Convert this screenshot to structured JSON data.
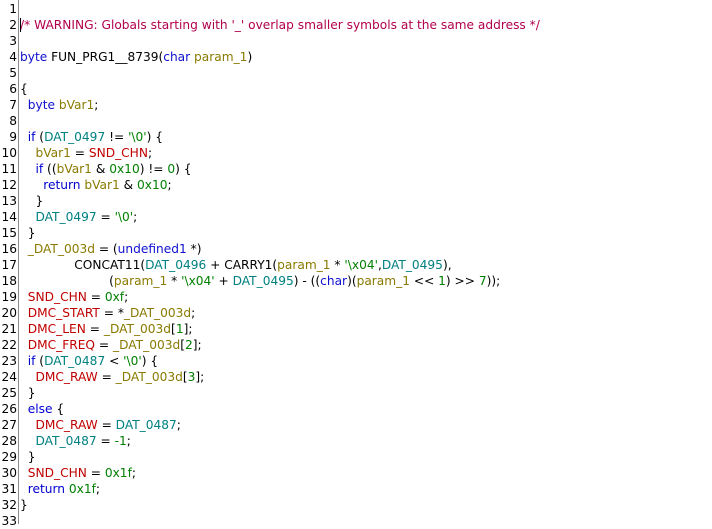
{
  "editor": {
    "lines": [
      {
        "n": "1",
        "tokens": []
      },
      {
        "n": "2",
        "tokens": [
          {
            "t": "/* WARNING: Globals starting with '_' overlap smaller symbols at the same address */",
            "c": "comment"
          }
        ]
      },
      {
        "n": "3",
        "tokens": []
      },
      {
        "n": "4",
        "tokens": [
          {
            "t": "byte ",
            "c": "type"
          },
          {
            "t": "FUN_PRG1__8739",
            "c": "func"
          },
          {
            "t": "(",
            "c": "plain"
          },
          {
            "t": "char ",
            "c": "type"
          },
          {
            "t": "param_1",
            "c": "param"
          },
          {
            "t": ")",
            "c": "plain"
          }
        ]
      },
      {
        "n": "5",
        "tokens": []
      },
      {
        "n": "6",
        "tokens": [
          {
            "t": "{",
            "c": "plain"
          }
        ]
      },
      {
        "n": "7",
        "tokens": [
          {
            "t": "  ",
            "c": "plain"
          },
          {
            "t": "byte ",
            "c": "type"
          },
          {
            "t": "bVar1",
            "c": "var"
          },
          {
            "t": ";",
            "c": "plain"
          }
        ]
      },
      {
        "n": "8",
        "tokens": []
      },
      {
        "n": "9",
        "tokens": [
          {
            "t": "  ",
            "c": "plain"
          },
          {
            "t": "if",
            "c": "keyword"
          },
          {
            "t": " (",
            "c": "plain"
          },
          {
            "t": "DAT_0497",
            "c": "global"
          },
          {
            "t": " != ",
            "c": "plain"
          },
          {
            "t": "'\\0'",
            "c": "const"
          },
          {
            "t": ") {",
            "c": "plain"
          }
        ]
      },
      {
        "n": "10",
        "tokens": [
          {
            "t": "    ",
            "c": "plain"
          },
          {
            "t": "bVar1",
            "c": "var"
          },
          {
            "t": " = ",
            "c": "plain"
          },
          {
            "t": "SND_CHN",
            "c": "sym"
          },
          {
            "t": ";",
            "c": "plain"
          }
        ]
      },
      {
        "n": "11",
        "tokens": [
          {
            "t": "    ",
            "c": "plain"
          },
          {
            "t": "if",
            "c": "keyword"
          },
          {
            "t": " ((",
            "c": "plain"
          },
          {
            "t": "bVar1",
            "c": "var"
          },
          {
            "t": " & ",
            "c": "plain"
          },
          {
            "t": "0x10",
            "c": "const"
          },
          {
            "t": ") != ",
            "c": "plain"
          },
          {
            "t": "0",
            "c": "const"
          },
          {
            "t": ") {",
            "c": "plain"
          }
        ]
      },
      {
        "n": "12",
        "tokens": [
          {
            "t": "      ",
            "c": "plain"
          },
          {
            "t": "return",
            "c": "keyword"
          },
          {
            "t": " ",
            "c": "plain"
          },
          {
            "t": "bVar1",
            "c": "var"
          },
          {
            "t": " & ",
            "c": "plain"
          },
          {
            "t": "0x10",
            "c": "const"
          },
          {
            "t": ";",
            "c": "plain"
          }
        ]
      },
      {
        "n": "13",
        "tokens": [
          {
            "t": "    }",
            "c": "plain"
          }
        ]
      },
      {
        "n": "14",
        "tokens": [
          {
            "t": "    ",
            "c": "plain"
          },
          {
            "t": "DAT_0497",
            "c": "global"
          },
          {
            "t": " = ",
            "c": "plain"
          },
          {
            "t": "'\\0'",
            "c": "const"
          },
          {
            "t": ";",
            "c": "plain"
          }
        ]
      },
      {
        "n": "15",
        "tokens": [
          {
            "t": "  }",
            "c": "plain"
          }
        ]
      },
      {
        "n": "16",
        "tokens": [
          {
            "t": "  ",
            "c": "plain"
          },
          {
            "t": "_DAT_003d",
            "c": "var"
          },
          {
            "t": " = (",
            "c": "plain"
          },
          {
            "t": "undefined1",
            "c": "type"
          },
          {
            "t": " *)",
            "c": "plain"
          }
        ]
      },
      {
        "n": "17",
        "tokens": [
          {
            "t": "              ",
            "c": "plain"
          },
          {
            "t": "CONCAT11",
            "c": "func"
          },
          {
            "t": "(",
            "c": "plain"
          },
          {
            "t": "DAT_0496",
            "c": "global"
          },
          {
            "t": " + ",
            "c": "plain"
          },
          {
            "t": "CARRY1",
            "c": "func"
          },
          {
            "t": "(",
            "c": "plain"
          },
          {
            "t": "param_1",
            "c": "param"
          },
          {
            "t": " * ",
            "c": "plain"
          },
          {
            "t": "'\\x04'",
            "c": "const"
          },
          {
            "t": ",",
            "c": "plain"
          },
          {
            "t": "DAT_0495",
            "c": "global"
          },
          {
            "t": "),",
            "c": "plain"
          }
        ]
      },
      {
        "n": "18",
        "tokens": [
          {
            "t": "                       (",
            "c": "plain"
          },
          {
            "t": "param_1",
            "c": "param"
          },
          {
            "t": " * ",
            "c": "plain"
          },
          {
            "t": "'\\x04'",
            "c": "const"
          },
          {
            "t": " + ",
            "c": "plain"
          },
          {
            "t": "DAT_0495",
            "c": "global"
          },
          {
            "t": ") - ((",
            "c": "plain"
          },
          {
            "t": "char",
            "c": "type"
          },
          {
            "t": ")(",
            "c": "plain"
          },
          {
            "t": "param_1",
            "c": "param"
          },
          {
            "t": " << ",
            "c": "plain"
          },
          {
            "t": "1",
            "c": "const"
          },
          {
            "t": ") >> ",
            "c": "plain"
          },
          {
            "t": "7",
            "c": "const"
          },
          {
            "t": "));",
            "c": "plain"
          }
        ]
      },
      {
        "n": "19",
        "tokens": [
          {
            "t": "  ",
            "c": "plain"
          },
          {
            "t": "SND_CHN",
            "c": "sym"
          },
          {
            "t": " = ",
            "c": "plain"
          },
          {
            "t": "0xf",
            "c": "const"
          },
          {
            "t": ";",
            "c": "plain"
          }
        ]
      },
      {
        "n": "20",
        "tokens": [
          {
            "t": "  ",
            "c": "plain"
          },
          {
            "t": "DMC_START",
            "c": "sym"
          },
          {
            "t": " = *",
            "c": "plain"
          },
          {
            "t": "_DAT_003d",
            "c": "var"
          },
          {
            "t": ";",
            "c": "plain"
          }
        ]
      },
      {
        "n": "21",
        "tokens": [
          {
            "t": "  ",
            "c": "plain"
          },
          {
            "t": "DMC_LEN",
            "c": "sym"
          },
          {
            "t": " = ",
            "c": "plain"
          },
          {
            "t": "_DAT_003d",
            "c": "var"
          },
          {
            "t": "[",
            "c": "plain"
          },
          {
            "t": "1",
            "c": "const"
          },
          {
            "t": "];",
            "c": "plain"
          }
        ]
      },
      {
        "n": "22",
        "tokens": [
          {
            "t": "  ",
            "c": "plain"
          },
          {
            "t": "DMC_FREQ",
            "c": "sym"
          },
          {
            "t": " = ",
            "c": "plain"
          },
          {
            "t": "_DAT_003d",
            "c": "var"
          },
          {
            "t": "[",
            "c": "plain"
          },
          {
            "t": "2",
            "c": "const"
          },
          {
            "t": "];",
            "c": "plain"
          }
        ]
      },
      {
        "n": "23",
        "tokens": [
          {
            "t": "  ",
            "c": "plain"
          },
          {
            "t": "if",
            "c": "keyword"
          },
          {
            "t": " (",
            "c": "plain"
          },
          {
            "t": "DAT_0487",
            "c": "global"
          },
          {
            "t": " < ",
            "c": "plain"
          },
          {
            "t": "'\\0'",
            "c": "const"
          },
          {
            "t": ") {",
            "c": "plain"
          }
        ]
      },
      {
        "n": "24",
        "tokens": [
          {
            "t": "    ",
            "c": "plain"
          },
          {
            "t": "DMC_RAW",
            "c": "sym"
          },
          {
            "t": " = ",
            "c": "plain"
          },
          {
            "t": "_DAT_003d",
            "c": "var"
          },
          {
            "t": "[",
            "c": "plain"
          },
          {
            "t": "3",
            "c": "const"
          },
          {
            "t": "];",
            "c": "plain"
          }
        ]
      },
      {
        "n": "25",
        "tokens": [
          {
            "t": "  }",
            "c": "plain"
          }
        ]
      },
      {
        "n": "26",
        "tokens": [
          {
            "t": "  ",
            "c": "plain"
          },
          {
            "t": "else",
            "c": "keyword"
          },
          {
            "t": " {",
            "c": "plain"
          }
        ]
      },
      {
        "n": "27",
        "tokens": [
          {
            "t": "    ",
            "c": "plain"
          },
          {
            "t": "DMC_RAW",
            "c": "sym"
          },
          {
            "t": " = ",
            "c": "plain"
          },
          {
            "t": "DAT_0487",
            "c": "global"
          },
          {
            "t": ";",
            "c": "plain"
          }
        ]
      },
      {
        "n": "28",
        "tokens": [
          {
            "t": "    ",
            "c": "plain"
          },
          {
            "t": "DAT_0487",
            "c": "global"
          },
          {
            "t": " = ",
            "c": "plain"
          },
          {
            "t": "-1",
            "c": "const"
          },
          {
            "t": ";",
            "c": "plain"
          }
        ]
      },
      {
        "n": "29",
        "tokens": [
          {
            "t": "  }",
            "c": "plain"
          }
        ]
      },
      {
        "n": "30",
        "tokens": [
          {
            "t": "  ",
            "c": "plain"
          },
          {
            "t": "SND_CHN",
            "c": "sym"
          },
          {
            "t": " = ",
            "c": "plain"
          },
          {
            "t": "0x1f",
            "c": "const"
          },
          {
            "t": ";",
            "c": "plain"
          }
        ]
      },
      {
        "n": "31",
        "tokens": [
          {
            "t": "  ",
            "c": "plain"
          },
          {
            "t": "return",
            "c": "keyword"
          },
          {
            "t": " ",
            "c": "plain"
          },
          {
            "t": "0x1f",
            "c": "const"
          },
          {
            "t": ";",
            "c": "plain"
          }
        ]
      },
      {
        "n": "32",
        "tokens": [
          {
            "t": "}",
            "c": "plain"
          }
        ]
      },
      {
        "n": "33",
        "tokens": []
      }
    ]
  },
  "colors": {
    "comment": "#b1004d",
    "keyword": "#0000d0",
    "type": "#1010d0",
    "global": "#008080",
    "const": "#008000",
    "var": "#8a7a00",
    "symbol": "#c00000",
    "gutter_border": "#8a8a8a"
  }
}
